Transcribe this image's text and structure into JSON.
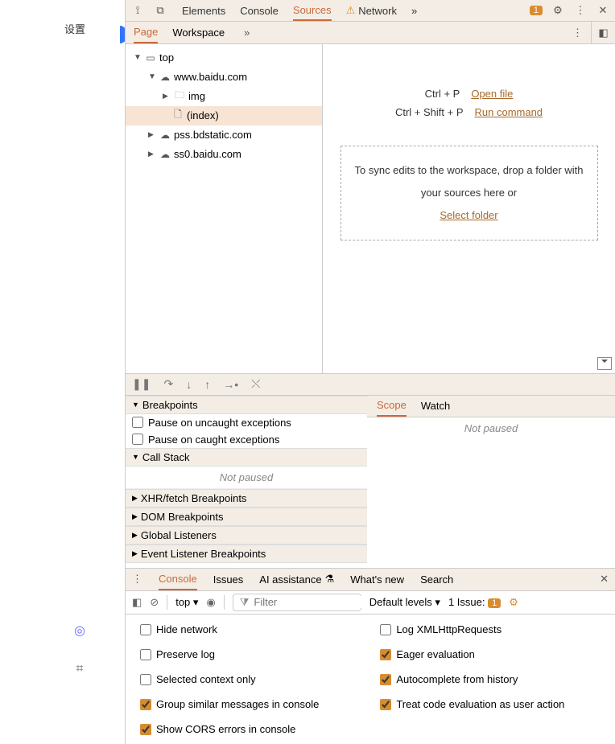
{
  "left": {
    "settings": "设置"
  },
  "toolbar": {
    "elements": "Elements",
    "console": "Console",
    "sources": "Sources",
    "network": "Network",
    "issues_count": "1"
  },
  "sourcesSub": {
    "page": "Page",
    "workspace": "Workspace"
  },
  "tree": {
    "top": "top",
    "baidu": "www.baidu.com",
    "img": "img",
    "index": "(index)",
    "pss": "pss.bdstatic.com",
    "ss0": "ss0.baidu.com"
  },
  "shortcuts": {
    "open_keys": "Ctrl + P",
    "open_label": "Open file",
    "run_keys": "Ctrl + Shift + P",
    "run_label": "Run command",
    "drop_text": "To sync edits to the workspace, drop a folder with your sources here or",
    "select_folder": "Select folder"
  },
  "bp": {
    "breakpoints": "Breakpoints",
    "pause_uncaught": "Pause on uncaught exceptions",
    "pause_caught": "Pause on caught exceptions",
    "callstack": "Call Stack",
    "not_paused": "Not paused",
    "xhr": "XHR/fetch Breakpoints",
    "dom": "DOM Breakpoints",
    "global": "Global Listeners",
    "event": "Event Listener Breakpoints"
  },
  "scope": {
    "scope": "Scope",
    "watch": "Watch",
    "not_paused": "Not paused"
  },
  "drawer": {
    "console": "Console",
    "issues": "Issues",
    "ai": "AI assistance",
    "whatsnew": "What's new",
    "search": "Search"
  },
  "consoleCtrl": {
    "context": "top ▾",
    "filter_ph": "Filter",
    "levels": "Default levels ▾",
    "issue_label": "1 Issue:",
    "issue_badge": "1"
  },
  "consoleOpts": {
    "hide_network": "Hide network",
    "preserve_log": "Preserve log",
    "selected_ctx": "Selected context only",
    "group_similar": "Group similar messages in console",
    "show_cors": "Show CORS errors in console",
    "log_xhr": "Log XMLHttpRequests",
    "eager_eval": "Eager evaluation",
    "autocomplete": "Autocomplete from history",
    "treat_eval": "Treat code evaluation as user action"
  }
}
